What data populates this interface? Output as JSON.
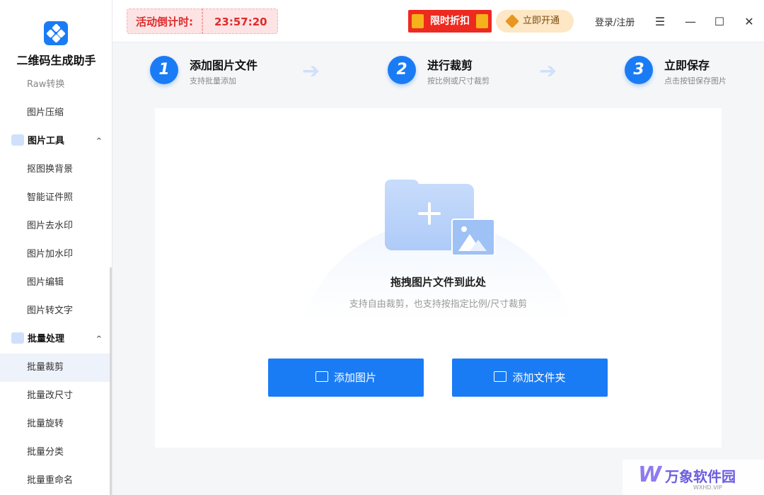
{
  "app": {
    "title": "二维码生成助手"
  },
  "sidebar": {
    "partial_item": "Raw转换",
    "item_compress": "图片压缩",
    "group_tools": "图片工具",
    "tools": [
      "抠图换背景",
      "智能证件照",
      "图片去水印",
      "图片加水印",
      "图片编辑",
      "图片转文字"
    ],
    "group_batch": "批量处理",
    "batch": [
      "批量裁剪",
      "批量改尺寸",
      "批量旋转",
      "批量分类",
      "批量重命名"
    ],
    "active_item": "批量裁剪",
    "caret": "^"
  },
  "topbar": {
    "countdown_label": "活动倒计时:",
    "countdown_time": "23:57:20",
    "promo_label": "限时折扣",
    "vip_label": "立即开通",
    "login_label": "登录/注册",
    "menu_icon": "☰",
    "min_icon": "—",
    "max_icon": "☐",
    "close_icon": "✕"
  },
  "steps": [
    {
      "num": "1",
      "title": "添加图片文件",
      "sub": "支持批量添加"
    },
    {
      "num": "2",
      "title": "进行裁剪",
      "sub": "按比例或尺寸裁剪"
    },
    {
      "num": "3",
      "title": "立即保存",
      "sub": "点击按钮保存图片"
    }
  ],
  "dropzone": {
    "title": "拖拽图片文件到此处",
    "subtitle": "支持自由裁剪，也支持按指定比例/尺寸裁剪",
    "add_image": "添加图片",
    "add_folder": "添加文件夹"
  },
  "watermark": {
    "logo": "W",
    "name": "万象软件园",
    "url": "WXHD.VIP"
  },
  "colors": {
    "accent": "#1a7cf5",
    "promo": "#ee2a20",
    "countdown": "#e02b2b"
  }
}
